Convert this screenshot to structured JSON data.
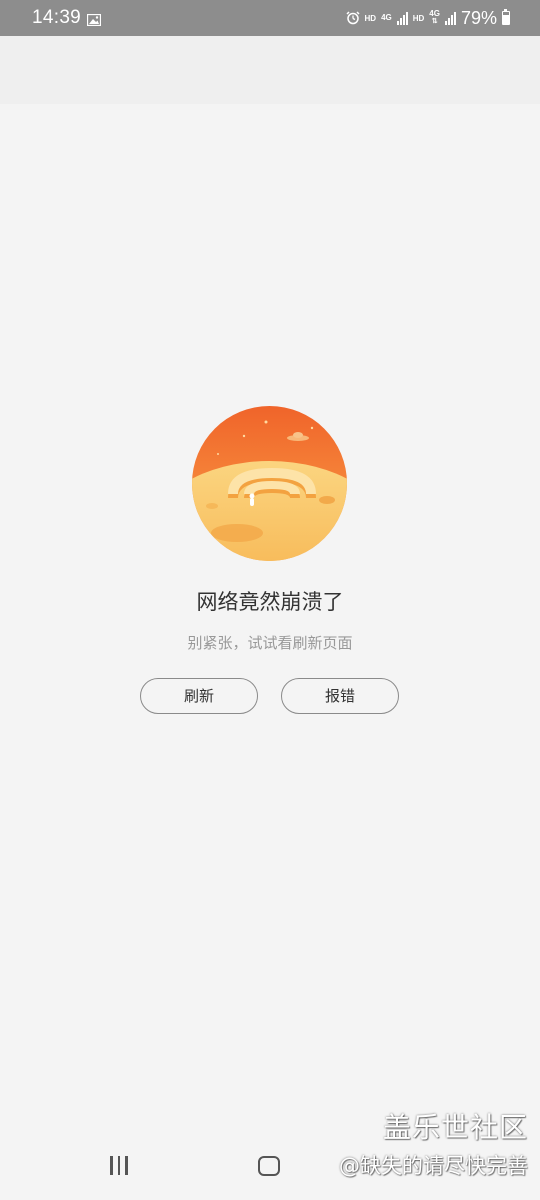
{
  "status_bar": {
    "time": "14:39",
    "hd_1": "HD",
    "net_1": "4G",
    "hd_2": "HD",
    "net_2": "4G",
    "battery": "79%",
    "battery_level": 0.79,
    "icons": [
      "gallery-icon",
      "alarm-icon",
      "signal-icon",
      "battery-icon"
    ]
  },
  "error": {
    "title": "网络竟然崩溃了",
    "subtitle": "别紧张，试试看刷新页面",
    "illustration_icon": "planet-wifi-icon"
  },
  "buttons": {
    "refresh": "刷新",
    "report": "报错"
  },
  "watermark": {
    "brand": "盖乐世社区",
    "user": "@缺失的请尽快完善"
  },
  "nav": {
    "icons": [
      "recents-icon",
      "home-icon"
    ]
  },
  "colors": {
    "background": "#f4f4f4",
    "status_bar": "#8d8d8d",
    "planet_top": "#f36a2a",
    "planet_bottom": "#f9c45a"
  }
}
